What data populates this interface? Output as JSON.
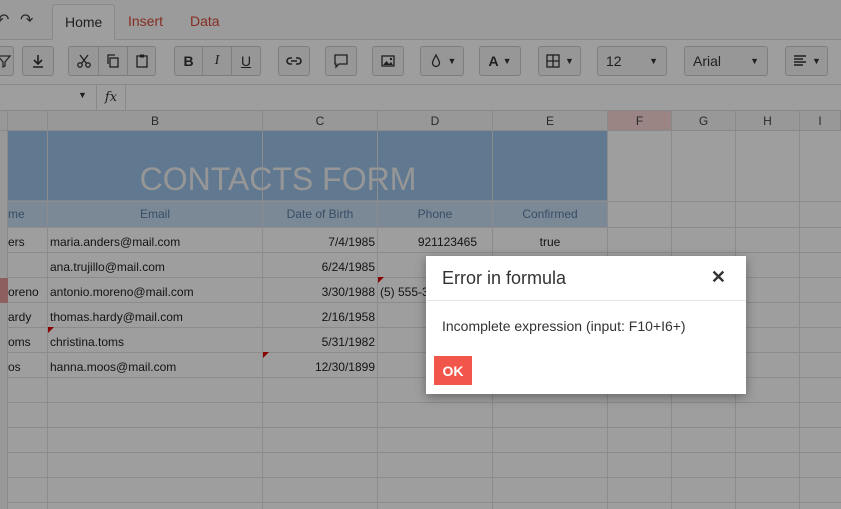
{
  "ribbon": {
    "tabs": [
      {
        "label": "Home",
        "active": true
      },
      {
        "label": "Insert",
        "active": false
      },
      {
        "label": "Data",
        "active": false
      }
    ]
  },
  "toolbar": {
    "font_size": "12",
    "font_family": "Arial"
  },
  "formula_bar": {
    "fx_label": "fx"
  },
  "grid": {
    "columns": [
      "B",
      "C",
      "D",
      "E",
      "F",
      "G",
      "H",
      "I"
    ],
    "selected_column": "F",
    "form_title": "CONTACTS FORM",
    "headers": {
      "name": "me",
      "email": "Email",
      "dob": "Date of Birth",
      "phone": "Phone",
      "confirmed": "Confirmed"
    },
    "rows": [
      {
        "name": "ers",
        "email": "maria.anders@mail.com",
        "dob": "7/4/1985",
        "phone": "921123465",
        "confirmed": "true"
      },
      {
        "name": "",
        "email": "ana.trujillo@mail.com",
        "dob": "6/24/1985",
        "phone": "",
        "confirmed": ""
      },
      {
        "name": "oreno",
        "email": "antonio.moreno@mail.com",
        "dob": "3/30/1988",
        "phone": "(5) 555-3",
        "confirmed": ""
      },
      {
        "name": "ardy",
        "email": "thomas.hardy@mail.com",
        "dob": "2/16/1958",
        "phone": "",
        "confirmed": ""
      },
      {
        "name": "oms",
        "email": "christina.toms",
        "dob": "5/31/1982",
        "phone": "",
        "confirmed": ""
      },
      {
        "name": "os",
        "email": "hanna.moos@mail.com",
        "dob": "12/30/1899",
        "phone": "",
        "confirmed": ""
      }
    ]
  },
  "dialog": {
    "title": "Error in formula",
    "close": "✕",
    "message": "Incomplete expression (input: F10+I6+)",
    "ok_label": "OK"
  },
  "colors": {
    "accent": "#d84a38",
    "ok_button": "#f2564a",
    "banner": "#9cc3ea"
  }
}
